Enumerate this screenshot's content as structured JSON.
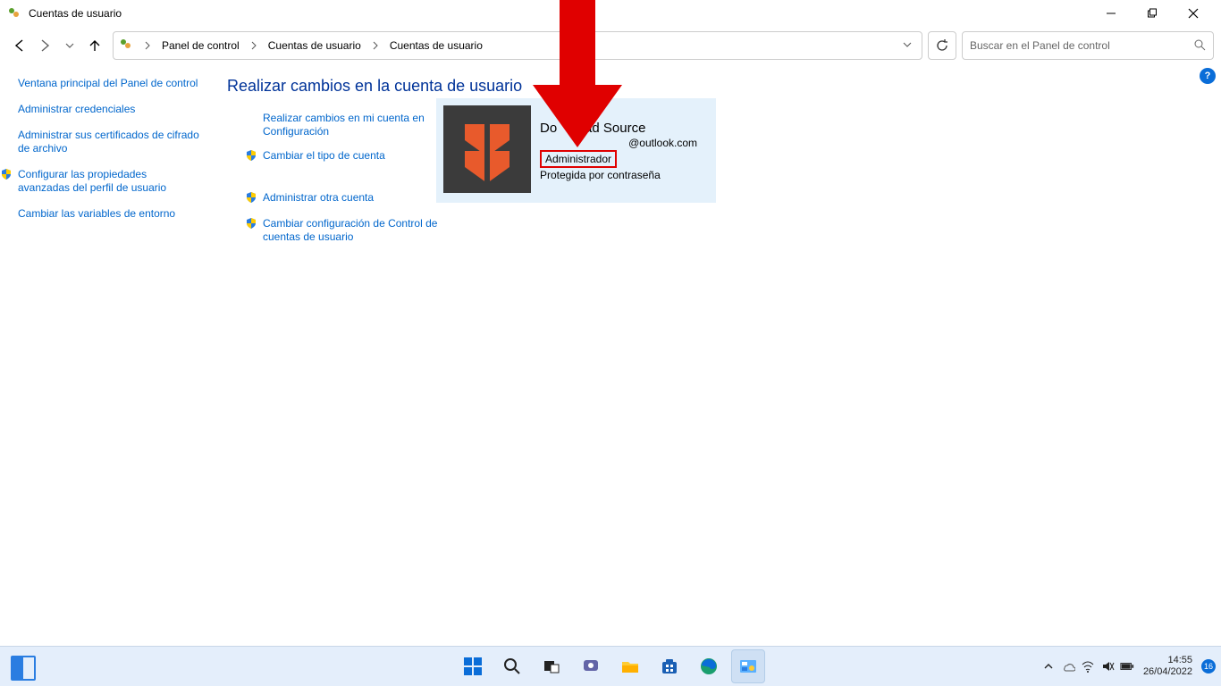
{
  "window": {
    "title": "Cuentas de usuario"
  },
  "breadcrumb": {
    "items": [
      "Panel de control",
      "Cuentas de usuario",
      "Cuentas de usuario"
    ]
  },
  "search": {
    "placeholder": "Buscar en el Panel de control"
  },
  "sidebar": {
    "items": [
      {
        "label": "Ventana principal del Panel de control",
        "shield": false
      },
      {
        "label": "Administrar credenciales",
        "shield": false
      },
      {
        "label": "Administrar sus certificados de cifrado de archivo",
        "shield": false
      },
      {
        "label": "Configurar las propiedades avanzadas del perfil de usuario",
        "shield": true
      },
      {
        "label": "Cambiar las variables de entorno",
        "shield": false
      }
    ]
  },
  "main": {
    "heading": "Realizar cambios en la cuenta de usuario",
    "tasks": [
      {
        "label": "Realizar cambios en mi cuenta en Configuración",
        "shield": false
      },
      {
        "label": "Cambiar el tipo de cuenta",
        "shield": true
      },
      {
        "label": "Administrar otra cuenta",
        "shield": true
      },
      {
        "label": "Cambiar configuración de Control de cuentas de usuario",
        "shield": true
      }
    ]
  },
  "account": {
    "name_partial_left": "Do",
    "name_partial_right": "oad Source",
    "email": "@outlook.com",
    "role": "Administrador",
    "protected": "Protegida por contraseña"
  },
  "taskbar": {
    "time": "14:55",
    "date": "26/04/2022",
    "notification_count": "16"
  }
}
